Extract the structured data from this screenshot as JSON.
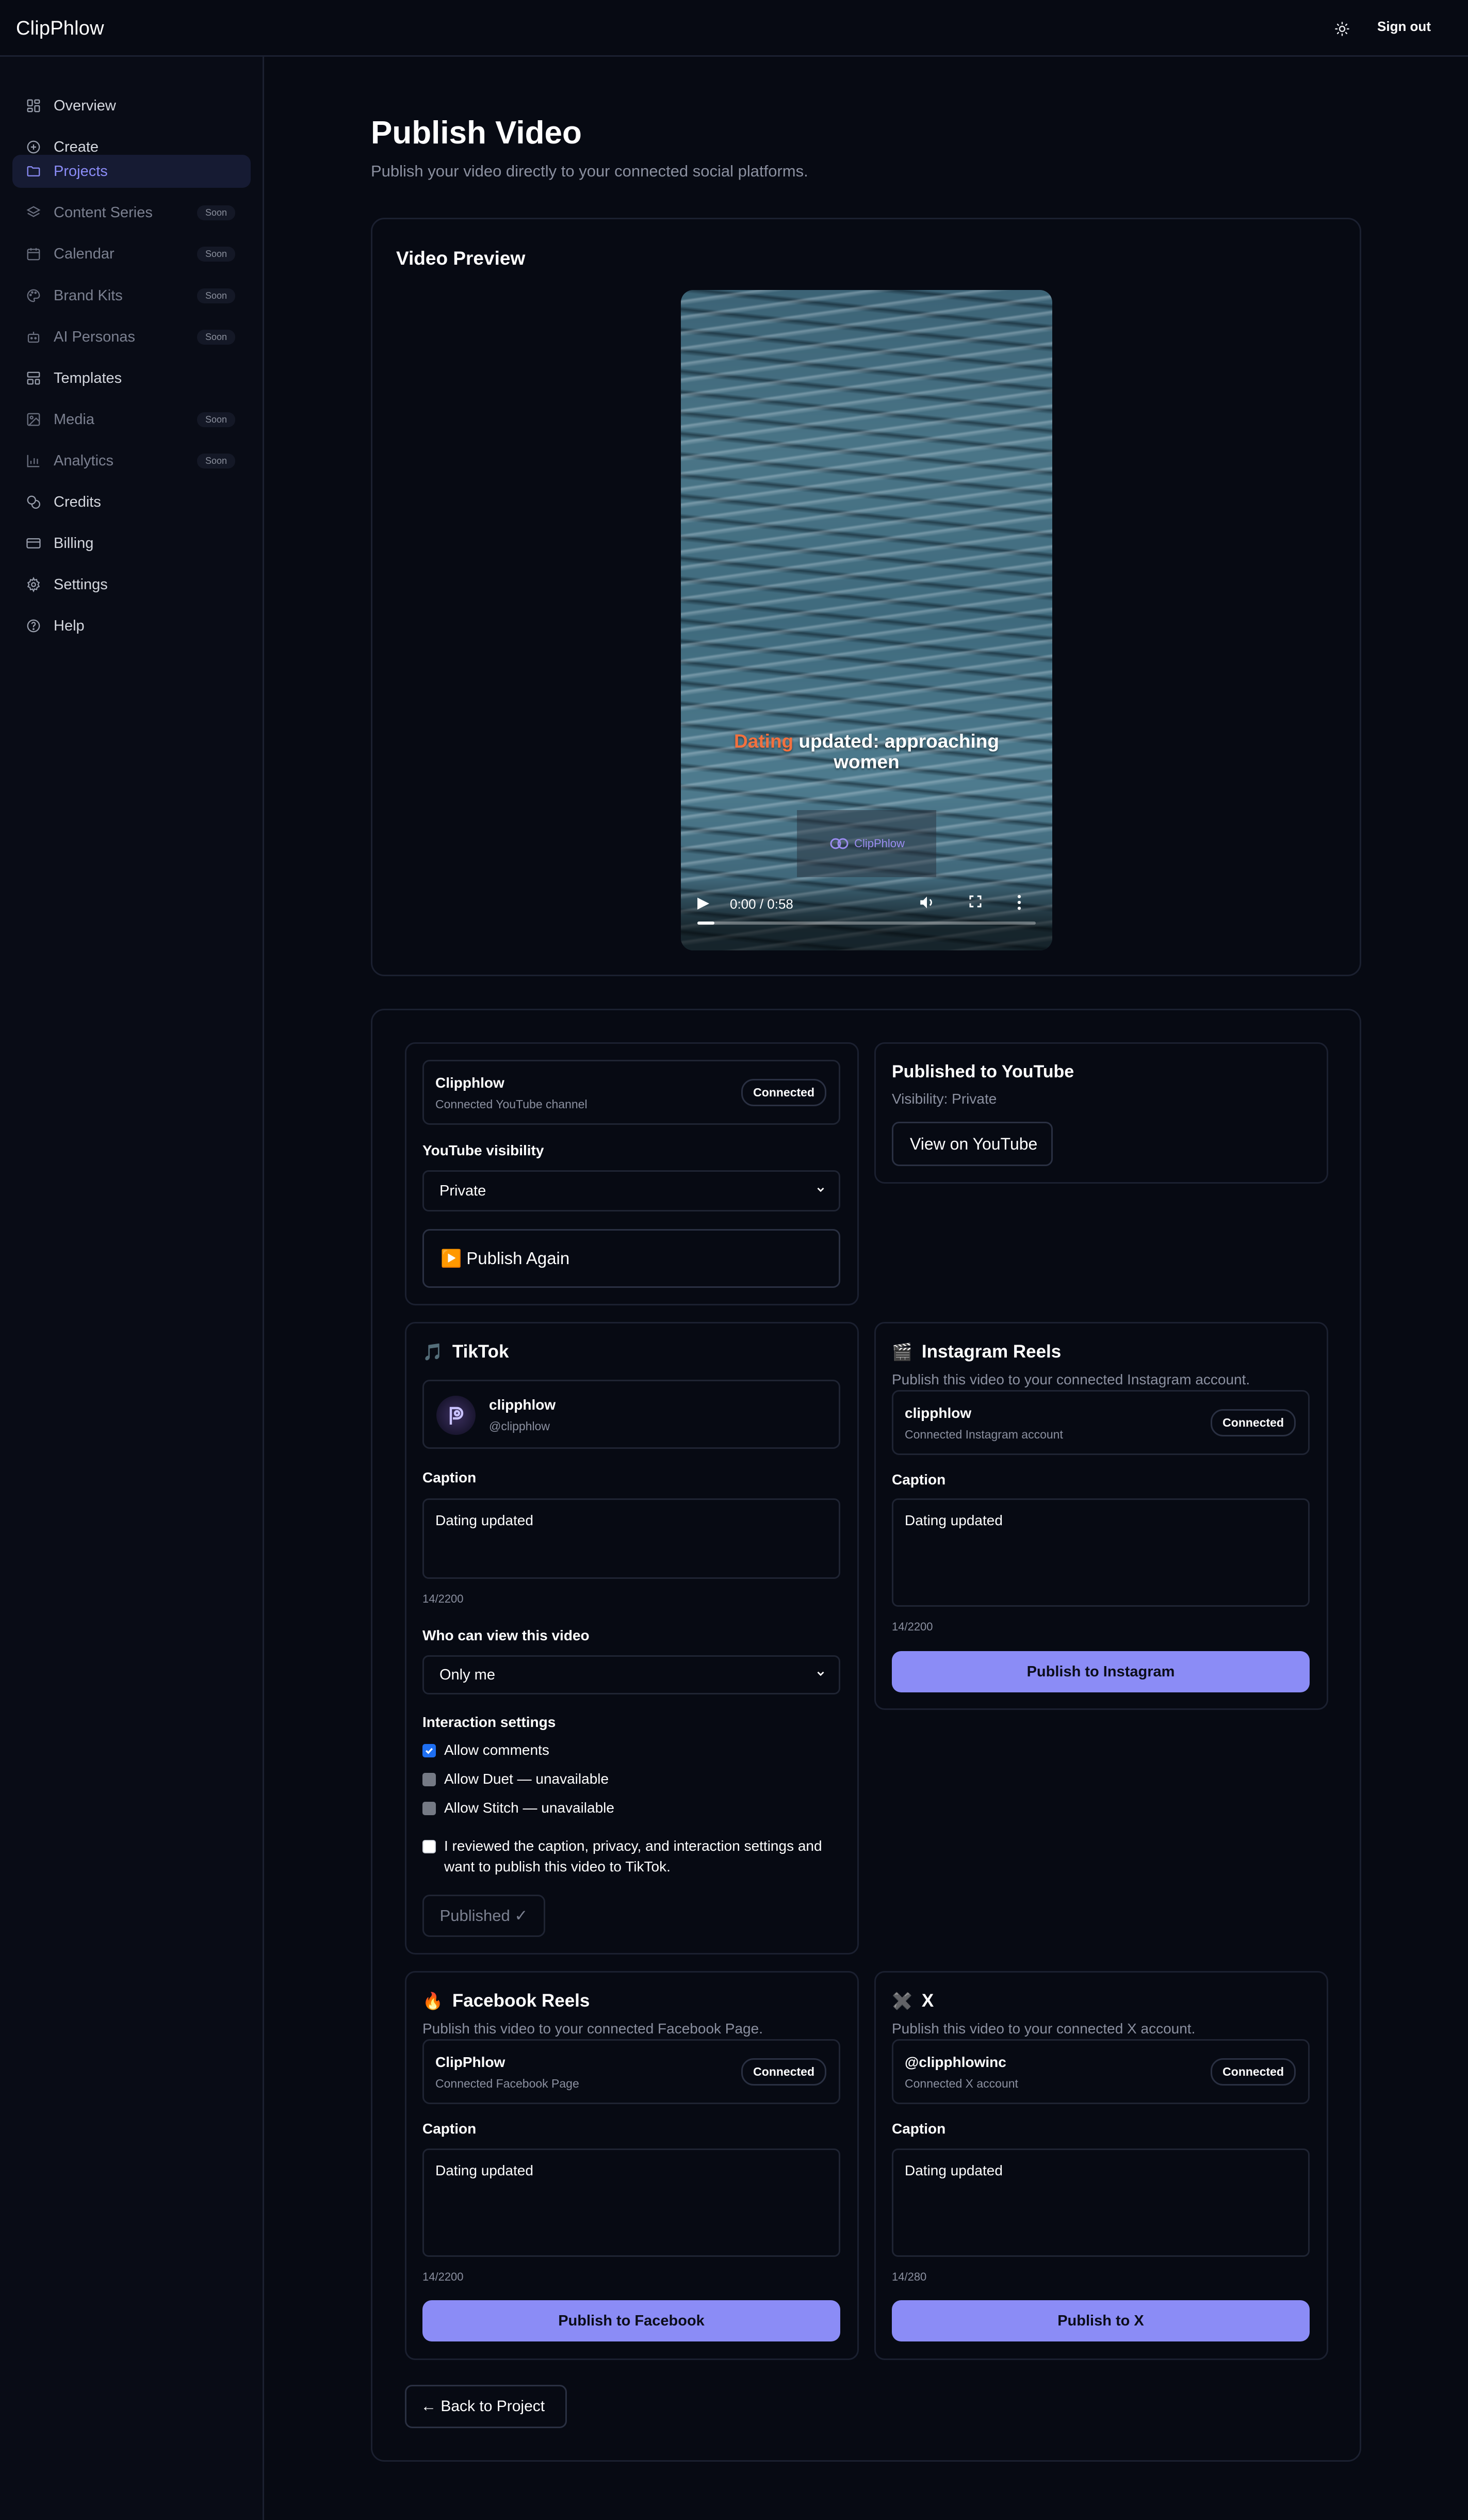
{
  "app": {
    "brand": "ClipPhlow",
    "sign_out": "Sign out"
  },
  "sidebar": {
    "items": [
      {
        "label": "Overview",
        "icon": "grid-icon",
        "soon": ""
      },
      {
        "label": "Create",
        "icon": "plus-circle-icon",
        "soon": ""
      },
      {
        "label": "Projects",
        "icon": "folder-icon",
        "soon": ""
      },
      {
        "label": "Content Series",
        "icon": "layers-icon",
        "soon": "Soon"
      },
      {
        "label": "Calendar",
        "icon": "calendar-icon",
        "soon": "Soon"
      },
      {
        "label": "Brand Kits",
        "icon": "palette-icon",
        "soon": "Soon"
      },
      {
        "label": "AI Personas",
        "icon": "bot-icon",
        "soon": "Soon"
      },
      {
        "label": "Templates",
        "icon": "template-icon",
        "soon": ""
      },
      {
        "label": "Media",
        "icon": "image-icon",
        "soon": "Soon"
      },
      {
        "label": "Analytics",
        "icon": "bar-chart-icon",
        "soon": "Soon"
      },
      {
        "label": "Credits",
        "icon": "coins-icon",
        "soon": ""
      },
      {
        "label": "Billing",
        "icon": "credit-card-icon",
        "soon": ""
      },
      {
        "label": "Settings",
        "icon": "gear-icon",
        "soon": ""
      },
      {
        "label": "Help",
        "icon": "help-circle-icon",
        "soon": ""
      }
    ]
  },
  "page": {
    "title": "Publish Video",
    "subtitle": "Publish your video directly to your connected social platforms."
  },
  "preview": {
    "title": "Video Preview",
    "caption_highlight": "Dating",
    "caption_rest": " updated: approaching",
    "caption_line2": "women",
    "watermark": "ClipPhlow",
    "time": "0:00 / 0:58",
    "progress": 0.05
  },
  "youtube": {
    "account_name": "Clipphlow",
    "account_desc": "Connected YouTube channel",
    "badge": "Connected",
    "visibility_label": "YouTube visibility",
    "visibility_value": "Private",
    "publish_again": "▶️ Publish Again",
    "published_title": "Published to YouTube",
    "published_visibility": "Visibility: Private",
    "view_button": "View on YouTube"
  },
  "tiktok": {
    "title": "TikTok",
    "emoji": "🎵",
    "account_name": "clipphlow",
    "account_handle": "@clipphlow",
    "caption_label": "Caption",
    "caption": "Dating updated",
    "count": "14/2200",
    "privacy_label": "Who can view this video",
    "privacy_value": "Only me",
    "interaction_label": "Interaction settings",
    "allow_comments": "Allow comments",
    "allow_duet": "Allow Duet — unavailable",
    "allow_stitch": "Allow Stitch — unavailable",
    "confirm_line1": "I reviewed the caption, privacy, and interaction settings and",
    "confirm_line2": "want to publish this video to TikTok.",
    "published": "Published ✓"
  },
  "instagram": {
    "title": "Instagram Reels",
    "emoji": "🎬",
    "desc": "Publish this video to your connected Instagram account.",
    "account_name": "clipphlow",
    "account_desc": "Connected Instagram account",
    "badge": "Connected",
    "caption_label": "Caption",
    "caption": "Dating updated",
    "count": "14/2200",
    "button": "Publish to Instagram"
  },
  "facebook": {
    "title": "Facebook Reels",
    "emoji": "🔥",
    "desc": "Publish this video to your connected Facebook Page.",
    "account_name": "ClipPhlow",
    "account_desc": "Connected Facebook Page",
    "badge": "Connected",
    "caption_label": "Caption",
    "caption": "Dating updated",
    "count": "14/2200",
    "button": "Publish to Facebook"
  },
  "x": {
    "title": "X",
    "emoji": "✖️",
    "desc": "Publish this video to your connected X account.",
    "account_name": "@clipphlowinc",
    "account_desc": "Connected X account",
    "badge": "Connected",
    "caption_label": "Caption",
    "caption": "Dating updated",
    "count": "14/280",
    "button": "Publish to X"
  },
  "back_button": "← Back to Project",
  "colors": {
    "accent": "#8b8cf6",
    "background": "#070a13",
    "border": "#1b2030",
    "caption_highlight": "#f2713f"
  }
}
